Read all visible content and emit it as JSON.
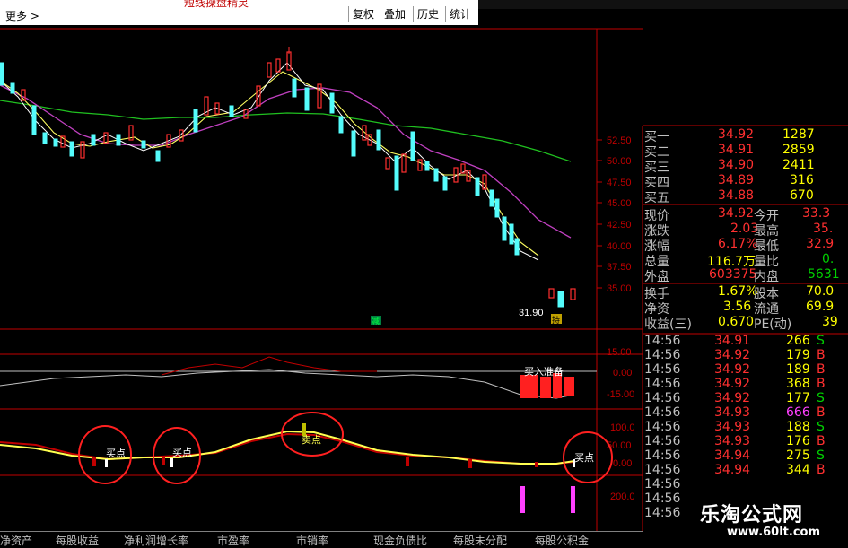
{
  "top_bar": {
    "title": "短线操盘精灵",
    "more": "更多 >",
    "buttons": [
      "复权",
      "叠加",
      "历史",
      "统计"
    ]
  },
  "price_axis": [
    "52.50",
    "50.00",
    "47.50",
    "45.00",
    "42.50",
    "40.00",
    "37.50",
    "35.00"
  ],
  "price_annotations": {
    "low": "31.90",
    "marker_green": "减",
    "marker_yellow": "持"
  },
  "indicator1": {
    "axis": [
      "15.00",
      "0.00",
      "-15.00"
    ],
    "label": "买入准备"
  },
  "indicator2": {
    "axis": [
      "100.0",
      "50.00",
      "0.00"
    ],
    "labels": [
      "买点",
      "买点",
      "卖点",
      "买点"
    ]
  },
  "indicator3": {
    "axis": [
      "200.0"
    ]
  },
  "order_book": [
    {
      "label": "买一",
      "price": "34.92",
      "vol": "1287"
    },
    {
      "label": "买二",
      "price": "34.91",
      "vol": "2859"
    },
    {
      "label": "买三",
      "price": "34.90",
      "vol": "2411"
    },
    {
      "label": "买四",
      "price": "34.89",
      "vol": "316"
    },
    {
      "label": "买五",
      "price": "34.88",
      "vol": "670"
    }
  ],
  "quote": [
    {
      "l1": "现价",
      "v1": "34.92",
      "l2": "今开",
      "v2": "33.3"
    },
    {
      "l1": "涨跌",
      "v1": "2.03",
      "l2": "最高",
      "v2": "35."
    },
    {
      "l1": "涨幅",
      "v1": "6.17%",
      "l2": "最低",
      "v2": "32.9"
    },
    {
      "l1": "总量",
      "v1": "116.7万",
      "l2": "量比",
      "v2": "0."
    },
    {
      "l1": "外盘",
      "v1": "603375",
      "l2": "内盘",
      "v2": "5631"
    },
    {
      "l1": "换手",
      "v1": "1.67%",
      "l2": "股本",
      "v2": "70.0"
    },
    {
      "l1": "净资",
      "v1": "3.56",
      "l2": "流通",
      "v2": "69.9"
    },
    {
      "l1": "收益(三)",
      "v1": "0.670",
      "l2": "PE(动)",
      "v2": "39"
    }
  ],
  "ticks": [
    {
      "time": "14:56",
      "price": "34.91",
      "vol": "266",
      "side": "S"
    },
    {
      "time": "14:56",
      "price": "34.92",
      "vol": "179",
      "side": "B"
    },
    {
      "time": "14:56",
      "price": "34.92",
      "vol": "189",
      "side": "B"
    },
    {
      "time": "14:56",
      "price": "34.92",
      "vol": "368",
      "side": "B"
    },
    {
      "time": "14:56",
      "price": "34.92",
      "vol": "177",
      "side": "S"
    },
    {
      "time": "14:56",
      "price": "34.93",
      "vol": "666",
      "side": "B"
    },
    {
      "time": "14:56",
      "price": "34.93",
      "vol": "188",
      "side": "S"
    },
    {
      "time": "14:56",
      "price": "34.93",
      "vol": "176",
      "side": "B"
    },
    {
      "time": "14:56",
      "price": "34.94",
      "vol": "275",
      "side": "S"
    },
    {
      "time": "14:56",
      "price": "34.94",
      "vol": "344",
      "side": "B"
    },
    {
      "time": "14:56",
      "price": "",
      "vol": "",
      "side": ""
    },
    {
      "time": "14:56",
      "price": "",
      "vol": "",
      "side": ""
    },
    {
      "time": "14:56",
      "price": "",
      "vol": "",
      "side": ""
    }
  ],
  "bottom_tabs": [
    "净资产",
    "每股收益",
    "净利润增长率",
    "市盈率",
    "市销率",
    "现金负债比",
    "每股未分配",
    "每股公积金"
  ],
  "watermark": {
    "name": "乐淘公式网",
    "url": "www.60lt.com"
  },
  "colors": {
    "up": "#ff3030",
    "down": "#54fcfc",
    "axis": "#c00000",
    "yellow": "#ffff00",
    "green": "#00d000",
    "magenta": "#ff40ff"
  }
}
